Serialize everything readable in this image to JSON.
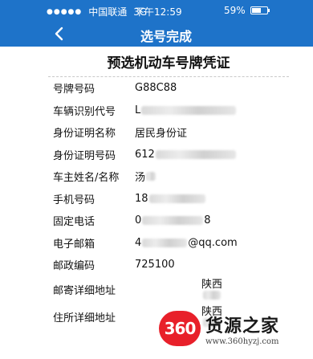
{
  "status_bar": {
    "signal_dots": "●●●●●",
    "carrier": "中国联通",
    "network": "3G",
    "time": "下午12:59",
    "battery_percent": "59%",
    "battery_level": 0.59
  },
  "nav": {
    "title": "选号完成",
    "back_icon": "chevron-left-icon"
  },
  "document": {
    "title": "预选机动车号牌凭证",
    "rows": [
      {
        "label": "号牌号码",
        "value": "G88C88"
      },
      {
        "label": "车辆识别代号",
        "prefix": "L",
        "suffix": ""
      },
      {
        "label": "身份证明名称",
        "value": "居民身份证"
      },
      {
        "label": "身份证明号码",
        "prefix": "612",
        "suffix": ""
      },
      {
        "label": "车主姓名/名称",
        "prefix": "汤",
        "suffix": ""
      },
      {
        "label": "手机号码",
        "prefix": "18",
        "suffix": ""
      },
      {
        "label": "固定电话",
        "prefix": "0",
        "suffix": "8"
      },
      {
        "label": "电子邮箱",
        "prefix": "4",
        "suffix": "@qq.com"
      },
      {
        "label": "邮政编码",
        "value": "725100"
      },
      {
        "label": "邮寄详细地址",
        "prefix": "陕西",
        "suffix": ""
      },
      {
        "label": "住所详细地址",
        "prefix": "陕西",
        "suffix": ""
      }
    ]
  },
  "watermark": {
    "logo_text": "360",
    "name": "货源之家",
    "url": "www.360hyzj.com"
  },
  "colors": {
    "header_blue": "#1e73c9",
    "logo_red": "#e8202a"
  }
}
